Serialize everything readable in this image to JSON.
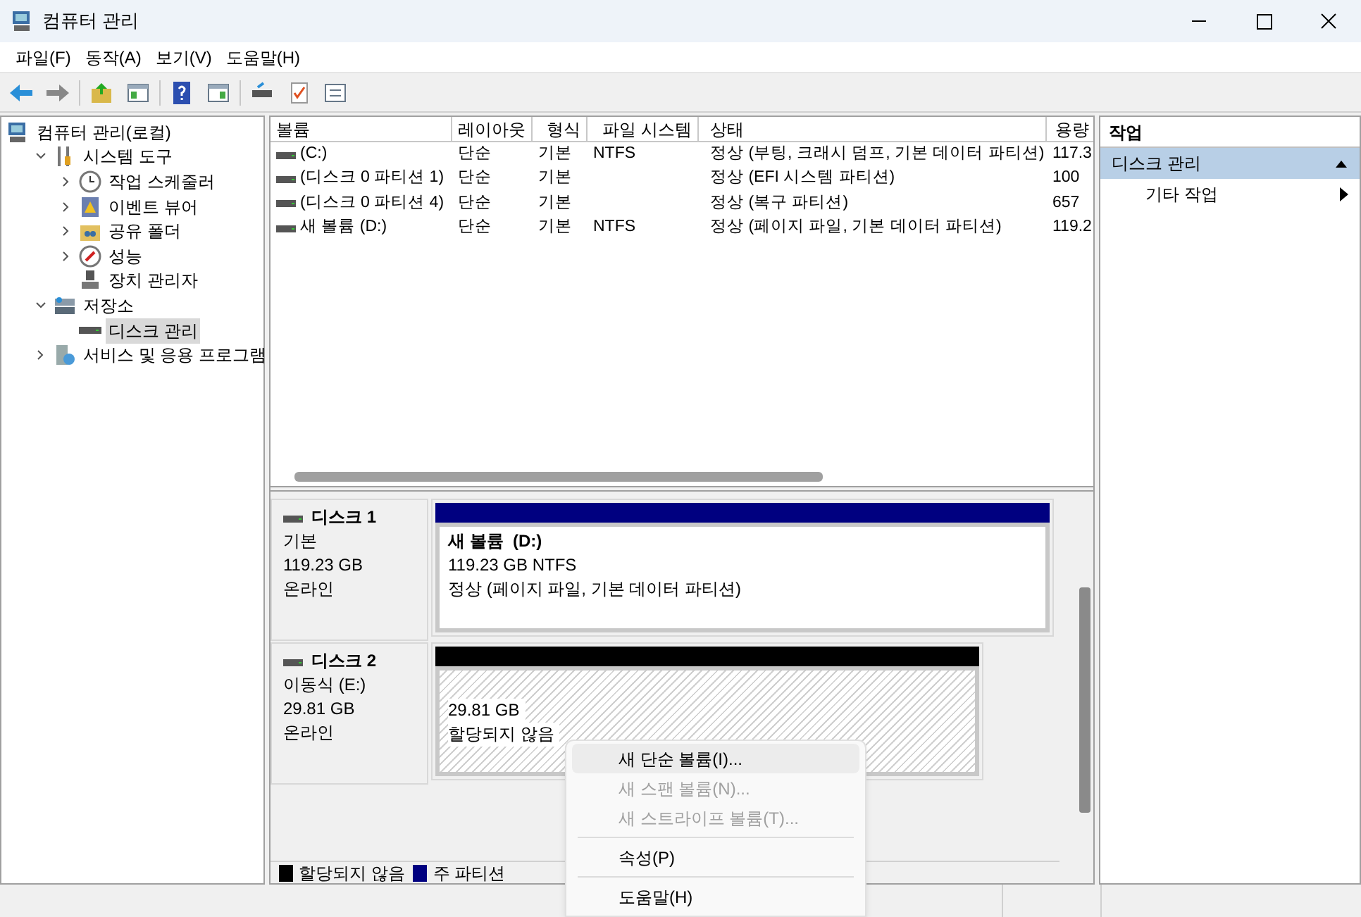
{
  "window": {
    "title": "컴퓨터 관리"
  },
  "menu_bar": [
    "파일(F)",
    "동작(A)",
    "보기(V)",
    "도움말(H)"
  ],
  "tree": [
    {
      "label": "컴퓨터 관리(로컬)",
      "kind": "computer",
      "selected": false,
      "children": [
        {
          "label": "시스템 도구",
          "kind": "tools",
          "selected": false,
          "expanded": true,
          "children": [
            {
              "label": "작업 스케줄러",
              "kind": "clock",
              "selected": false,
              "expanded": false
            },
            {
              "label": "이벤트 뷰어",
              "kind": "log",
              "selected": false,
              "expanded": false
            },
            {
              "label": "공유 폴더",
              "kind": "folder",
              "selected": false,
              "expanded": false
            },
            {
              "label": "성능",
              "kind": "gauge",
              "selected": false,
              "expanded": false
            },
            {
              "label": "장치 관리자",
              "kind": "device",
              "selected": false
            }
          ]
        },
        {
          "label": "저장소",
          "kind": "storage",
          "selected": false,
          "expanded": true,
          "children": [
            {
              "label": "디스크 관리",
              "kind": "drive",
              "selected": true
            }
          ]
        },
        {
          "label": "서비스 및 응용 프로그램",
          "kind": "services",
          "selected": false,
          "expanded": false
        }
      ]
    }
  ],
  "table": {
    "columns": [
      "볼륨",
      "레이아웃",
      "형식",
      "파일 시스템",
      "상태",
      "용량"
    ],
    "rows": [
      [
        "(C:)",
        "단순",
        "기본",
        "NTFS",
        "정상 (부팅, 크래시 덤프, 기본 데이터 파티션)",
        "117.3"
      ],
      [
        "(디스크 0 파티션 1)",
        "단순",
        "기본",
        "",
        "정상 (EFI 시스템 파티션)",
        "100"
      ],
      [
        "(디스크 0 파티션 4)",
        "단순",
        "기본",
        "",
        "정상 (복구 파티션)",
        "657"
      ],
      [
        "새 볼륨 (D:)",
        "단순",
        "기본",
        "NTFS",
        "정상 (페이지 파일, 기본 데이터 파티션)",
        "119.2"
      ]
    ]
  },
  "disks": [
    {
      "name": "디스크 1",
      "type": "기본",
      "size": "119.23 GB",
      "status": "온라인",
      "partition": {
        "kind": "primary",
        "title": "새 볼륨  (D:)",
        "size": "119.23 GB NTFS",
        "status": "정상 (페이지 파일, 기본 데이터 파티션)"
      }
    },
    {
      "name": "디스크 2",
      "type": "이동식 (E:)",
      "size": "29.81 GB",
      "status": "온라인",
      "partition": {
        "kind": "unallocated",
        "size": "29.81 GB",
        "status": "할당되지 않음"
      }
    }
  ],
  "legend": [
    {
      "label": "할당되지 않음",
      "color": "#000000"
    },
    {
      "label": "주 파티션",
      "color": "#000080"
    }
  ],
  "actions": {
    "title": "작업",
    "section": {
      "label": "디스크 관리",
      "expanded": true
    },
    "items": [
      "기타 작업"
    ]
  },
  "context_menu": [
    {
      "kind": "item",
      "label": "새 단순 볼륨(I)...",
      "disabled": false,
      "selected": true
    },
    {
      "kind": "item",
      "label": "새 스팬 볼륨(N)...",
      "disabled": true,
      "selected": false
    },
    {
      "kind": "item",
      "label": "새 스트라이프 볼륨(T)...",
      "disabled": true,
      "selected": false
    },
    {
      "kind": "separator"
    },
    {
      "kind": "item",
      "label": "속성(P)",
      "disabled": false,
      "selected": false
    },
    {
      "kind": "separator"
    },
    {
      "kind": "item",
      "label": "도움말(H)",
      "disabled": false,
      "selected": false
    }
  ]
}
